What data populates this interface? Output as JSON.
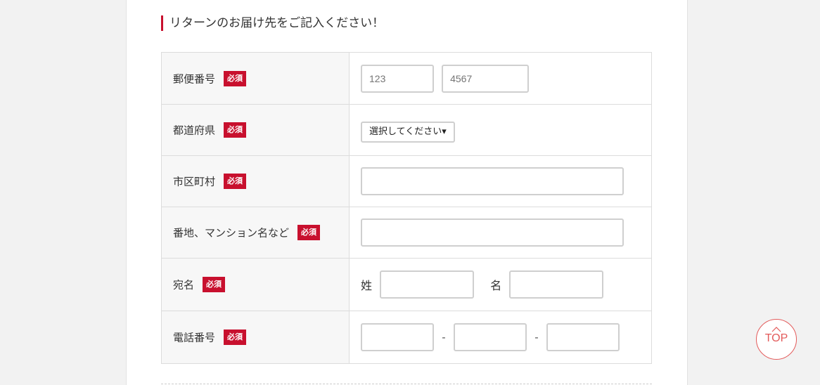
{
  "heading": "リターンのお届け先をご記入ください！",
  "required_label": "必須",
  "rows": {
    "postal": {
      "label": "郵便番号",
      "placeholder1": "123",
      "placeholder2": "4567"
    },
    "prefecture": {
      "label": "都道府県",
      "selected": "選択してください▾"
    },
    "city": {
      "label": "市区町村"
    },
    "address": {
      "label": "番地、マンション名など"
    },
    "name": {
      "label": "宛名",
      "last_name_label": "姓",
      "first_name_label": "名"
    },
    "phone": {
      "label": "電話番号",
      "separator": "-"
    }
  },
  "top_button": {
    "label": "TOP"
  },
  "colors": {
    "accent": "#c8102e",
    "top_button": "#e35a5a"
  }
}
